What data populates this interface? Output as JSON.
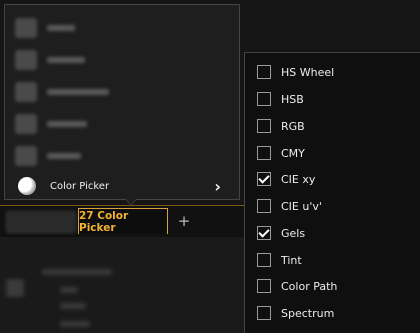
{
  "left_menu": {
    "items": [
      {
        "label": "",
        "blurred": true,
        "text_width": 28
      },
      {
        "label": "",
        "blurred": true,
        "text_width": 38
      },
      {
        "label": "",
        "blurred": true,
        "text_width": 62
      },
      {
        "label": "",
        "blurred": true,
        "text_width": 40
      },
      {
        "label": "",
        "blurred": true,
        "text_width": 34
      }
    ],
    "active_item": {
      "label": "Color Picker",
      "icon": "color-picker-icon",
      "chevron": "›"
    }
  },
  "tab_bar": {
    "active_tab_label": "27 Color Picker",
    "add_tab": "+"
  },
  "submenu": {
    "items": [
      {
        "label": "HS Wheel",
        "checked": false
      },
      {
        "label": "HSB",
        "checked": false
      },
      {
        "label": "RGB",
        "checked": false
      },
      {
        "label": "CMY",
        "checked": false
      },
      {
        "label": "CIE xy",
        "checked": true
      },
      {
        "label": "CIE u'v'",
        "checked": false
      },
      {
        "label": "Gels",
        "checked": true
      },
      {
        "label": "Tint",
        "checked": false
      },
      {
        "label": "Color Path",
        "checked": false
      },
      {
        "label": "Spectrum",
        "checked": false
      }
    ]
  },
  "colors": {
    "accent": "#f2b234",
    "checkmark": "#ffffff"
  }
}
